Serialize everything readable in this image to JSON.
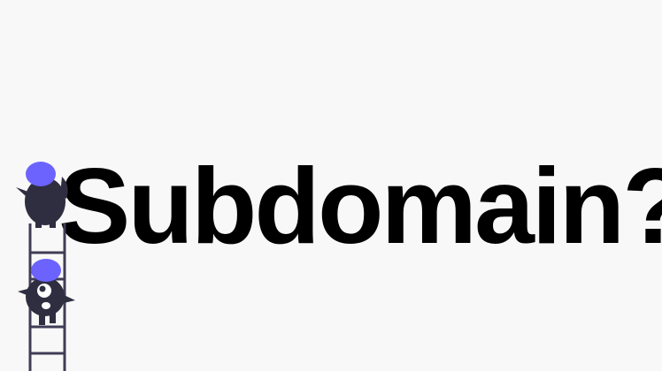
{
  "headline": "Subdomain?",
  "colors": {
    "background": "#f8f8f8",
    "text": "#000000",
    "accent": "#6c63ff",
    "figure": "#2f2e41"
  }
}
